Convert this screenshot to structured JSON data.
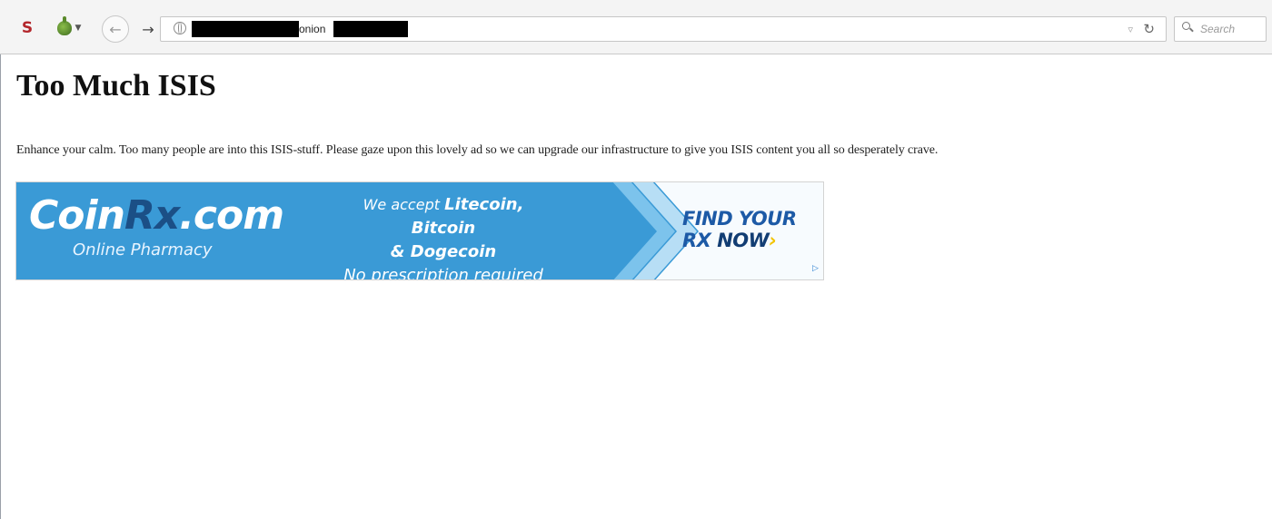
{
  "browser": {
    "address": {
      "visible_fragment": "onion"
    },
    "search_placeholder": "Search"
  },
  "page": {
    "heading": "Too Much ISIS",
    "body": "Enhance your calm. Too many people are into this ISIS-stuff. Please gaze upon this lovely ad so we can upgrade our infrastructure to give you ISIS content you all so desperately crave."
  },
  "ad": {
    "logo_prefix": "Coin",
    "logo_rx": "Rx",
    "logo_suffix": ".com",
    "tagline": "Online Pharmacy",
    "accept_prefix": "We accept",
    "accept_coins": "Litecoin, Bitcoin",
    "accept_line2": "& Dogecoin",
    "accept_line3": "No prescription required",
    "cta_line1": "FIND YOUR",
    "cta_rx": "RX",
    "cta_now": "NOW",
    "cta_arrow": "›",
    "colors": {
      "background": "#3a9ad6",
      "logo_rx": "#1b4f86",
      "cta_text": "#1d5aa6",
      "cta_arrow": "#f2c300"
    }
  },
  "icons": [
    "addon-s-icon",
    "onion-icon",
    "back-arrow-icon",
    "forward-arrow-icon",
    "globe-icon",
    "dropdown-icon",
    "reload-icon",
    "search-icon",
    "adchoices-icon"
  ]
}
